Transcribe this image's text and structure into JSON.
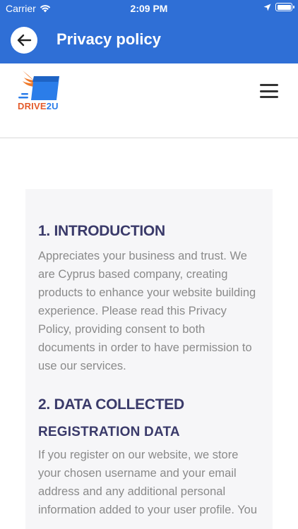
{
  "status_bar": {
    "carrier": "Carrier",
    "time": "2:09 PM"
  },
  "app_bar": {
    "title": "Privacy policy"
  },
  "site_header": {
    "logo_text_part1": "DRIVE",
    "logo_text_part2": "2U"
  },
  "content": {
    "section1_title": "1. INTRODUCTION",
    "section1_body": "Appreciates your business and trust. We are Cyprus based company, creating products to enhance your website building experience. Please read this Privacy Policy, providing consent to both documents in order to have permission to use our services.",
    "section2_title": "2. DATA COLLECTED",
    "section2_subtitle": "REGISTRATION DATA",
    "section2_body": "If you register on our website, we store your chosen username and your email address and any additional personal information added to your user profile. You"
  },
  "colors": {
    "brand_blue": "#2f6fd6",
    "heading": "#3a3a6a",
    "body_text": "#8a8a8a",
    "logo_orange": "#e35b2c",
    "logo_blue": "#2b7de9"
  },
  "icons": [
    "wifi-icon",
    "location-arrow-icon",
    "battery-icon",
    "back-arrow-icon",
    "hamburger-menu-icon"
  ]
}
